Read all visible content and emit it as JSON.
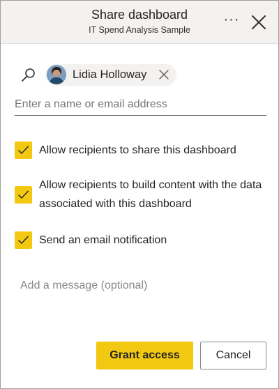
{
  "dialog": {
    "title": "Share dashboard",
    "subtitle": "IT Spend Analysis Sample",
    "more_label": "···",
    "close_icon": "close-icon"
  },
  "recipients": {
    "search_icon": "search-icon",
    "chips": [
      {
        "name": "Lidia Holloway",
        "avatar": "avatar-photo",
        "remove_icon": "dismiss-icon"
      }
    ],
    "input_placeholder": "Enter a name or email address",
    "input_value": ""
  },
  "options": [
    {
      "label": "Allow recipients to share this dashboard",
      "checked": true
    },
    {
      "label": "Allow recipients to build content with the data associated with this dashboard",
      "checked": true
    },
    {
      "label": "Send an email notification",
      "checked": true
    }
  ],
  "message": {
    "placeholder": "Add a message (optional)",
    "value": ""
  },
  "actions": {
    "grant_label": "Grant access",
    "cancel_label": "Cancel"
  },
  "colors": {
    "accent": "#f2c811",
    "header_bg": "#f3f2f1",
    "border": "#a19f9d"
  }
}
